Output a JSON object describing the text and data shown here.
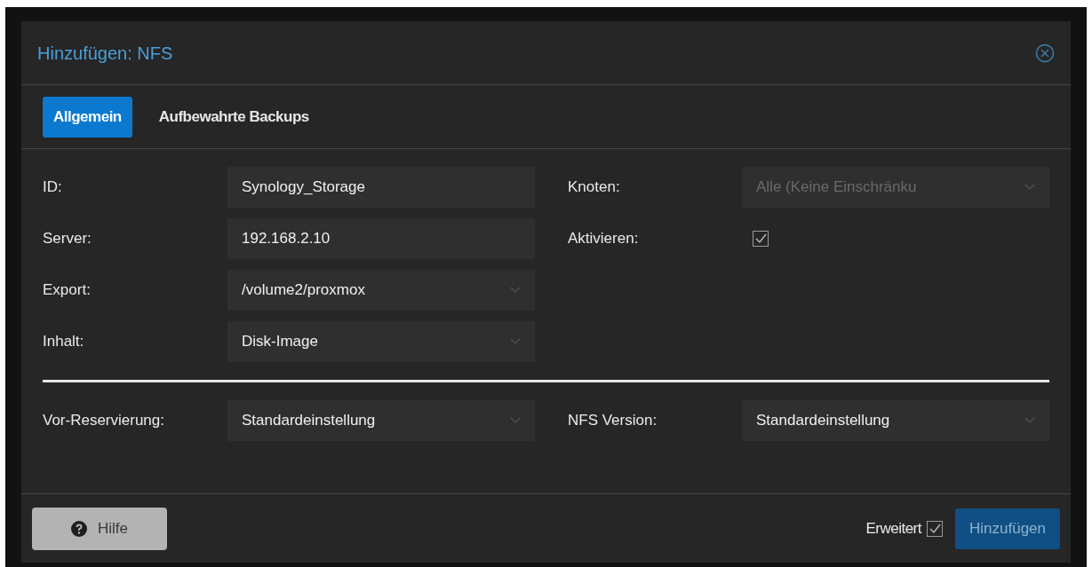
{
  "window": {
    "title": "Hinzufügen: NFS"
  },
  "tabs": [
    {
      "label": "Allgemein",
      "selected": true
    },
    {
      "label": "Aufbewahrte Backups",
      "selected": false
    }
  ],
  "general": {
    "left_fields": [
      {
        "label": "ID:",
        "kind": "text",
        "value": "Synology_Storage",
        "disabled": false
      },
      {
        "label": "Server:",
        "kind": "text",
        "value": "192.168.2.10",
        "disabled": false
      },
      {
        "label": "Export:",
        "kind": "select",
        "value": "/volume2/proxmox",
        "disabled": false
      },
      {
        "label": "Inhalt:",
        "kind": "select",
        "value": "Disk-Image",
        "disabled": false
      }
    ],
    "right_fields": [
      {
        "label": "Knoten:",
        "kind": "select",
        "value": "Alle (Keine Einschränku",
        "disabled": true
      },
      {
        "label": "Aktivieren:",
        "kind": "checkbox",
        "checked": true
      }
    ]
  },
  "advanced": {
    "left_fields": [
      {
        "label": "Vor-Reservierung:",
        "kind": "select",
        "value": "Standardeinstellung",
        "disabled": false
      }
    ],
    "right_fields": [
      {
        "label": "NFS Version:",
        "kind": "select",
        "value": "Standardeinstellung",
        "disabled": false
      }
    ]
  },
  "footer": {
    "help_button": "Hilfe",
    "advanced_toggle": {
      "label": "Erweitert",
      "checked": true
    },
    "submit_button": {
      "label": "Hinzufügen",
      "disabled": true
    }
  }
}
